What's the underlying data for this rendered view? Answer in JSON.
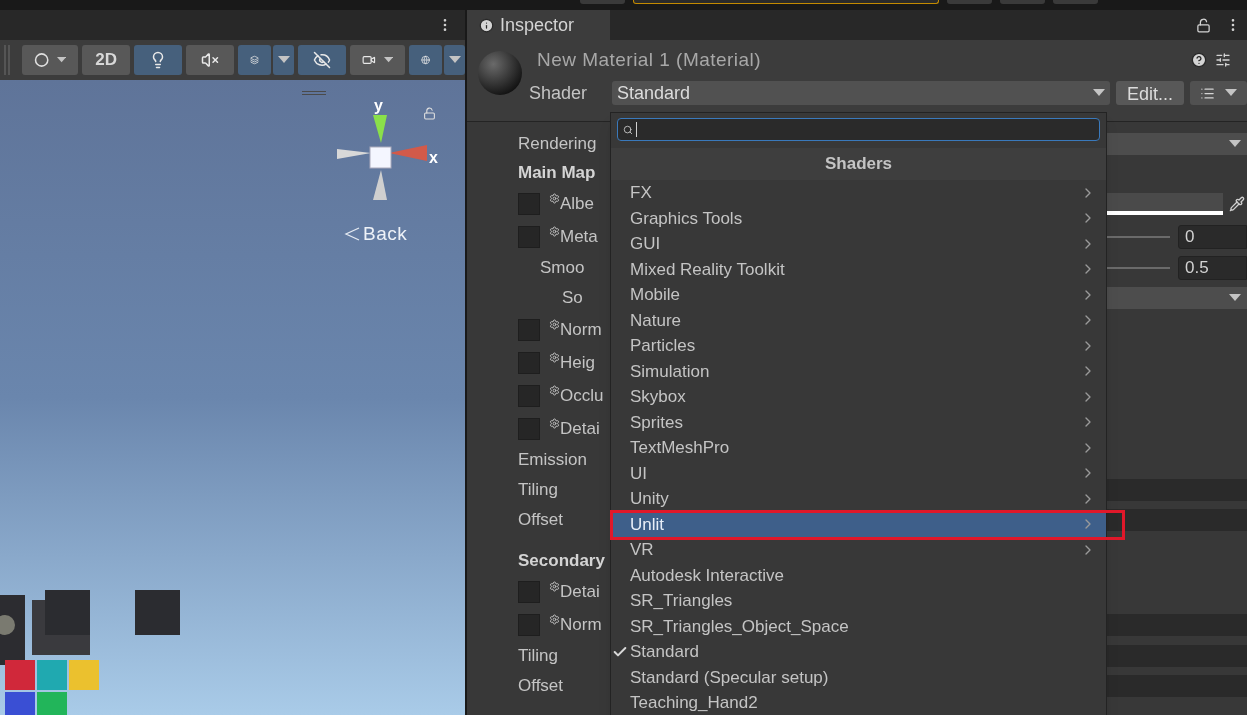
{
  "top_toolbar": [
    {
      "kind": "plain"
    },
    {
      "kind": "accent"
    },
    {
      "kind": "plain"
    },
    {
      "kind": "plain"
    },
    {
      "kind": "plain"
    }
  ],
  "scene": {
    "toolbar": [
      {
        "kind": "draw-mode",
        "on": false,
        "caret": true,
        "split": false
      },
      {
        "kind": "text",
        "label": "2D",
        "on": false,
        "caret": false,
        "split": false
      },
      {
        "kind": "lighting",
        "on": true,
        "caret": false,
        "split": false
      },
      {
        "kind": "audio",
        "on": false,
        "caret": false,
        "split": false
      },
      {
        "kind": "effects",
        "on": true,
        "caret": false,
        "split": true
      },
      {
        "kind": "visibility",
        "on": true,
        "caret": false,
        "split": false
      },
      {
        "kind": "camera",
        "on": false,
        "caret": true,
        "split": false
      },
      {
        "kind": "gizmos",
        "on": true,
        "caret": false,
        "split": true
      }
    ],
    "gizmo": {
      "y_label": "y",
      "x_label": "x",
      "view_label": "Back"
    }
  },
  "inspector": {
    "tab": "Inspector",
    "title": "New Material 1 (Material)",
    "shader_label": "Shader",
    "shader_value": "Standard",
    "edit_button": "Edit...",
    "properties": [
      {
        "kind": "plain",
        "label": "Rendering",
        "value": {
          "kind": "dropdown"
        }
      },
      {
        "kind": "heading",
        "label": "Main Map"
      },
      {
        "kind": "texture",
        "label": "Albe",
        "value": {
          "kind": "color"
        }
      },
      {
        "kind": "texture",
        "label": "Meta",
        "value": {
          "kind": "slider",
          "text": "0"
        },
        "children": [
          {
            "kind": "plain",
            "label": "Smoo",
            "value": {
              "kind": "slider",
              "text": "0.5"
            },
            "children": [
              {
                "kind": "plain",
                "label": "So",
                "value": {
                  "kind": "dropdown"
                }
              }
            ]
          }
        ]
      },
      {
        "kind": "texture",
        "label": "Norm"
      },
      {
        "kind": "texture",
        "label": "Heig"
      },
      {
        "kind": "texture",
        "label": "Occlu"
      },
      {
        "kind": "texture",
        "label": "Detai"
      },
      {
        "kind": "plain",
        "label": "Emission"
      },
      {
        "kind": "plain",
        "label": "Tiling",
        "value": {
          "kind": "field"
        }
      },
      {
        "kind": "plain",
        "label": "Offset",
        "value": {
          "kind": "field"
        }
      },
      {
        "kind": "heading",
        "label": "Secondary"
      },
      {
        "kind": "texture",
        "label": "Detai"
      },
      {
        "kind": "texture",
        "label": "Norm",
        "value": {
          "kind": "field"
        }
      },
      {
        "kind": "plain",
        "label": "Tiling",
        "value": {
          "kind": "field"
        }
      },
      {
        "kind": "plain",
        "label": "Offset",
        "value": {
          "kind": "field"
        }
      }
    ]
  },
  "shader_menu": {
    "title": "Shaders",
    "items": [
      {
        "label": "FX",
        "submenu": true,
        "selected": false,
        "checked": false,
        "outlined": false
      },
      {
        "label": "Graphics Tools",
        "submenu": true,
        "selected": false,
        "checked": false,
        "outlined": false
      },
      {
        "label": "GUI",
        "submenu": true,
        "selected": false,
        "checked": false,
        "outlined": false
      },
      {
        "label": "Mixed Reality Toolkit",
        "submenu": true,
        "selected": false,
        "checked": false,
        "outlined": false
      },
      {
        "label": "Mobile",
        "submenu": true,
        "selected": false,
        "checked": false,
        "outlined": false
      },
      {
        "label": "Nature",
        "submenu": true,
        "selected": false,
        "checked": false,
        "outlined": false
      },
      {
        "label": "Particles",
        "submenu": true,
        "selected": false,
        "checked": false,
        "outlined": false
      },
      {
        "label": "Simulation",
        "submenu": true,
        "selected": false,
        "checked": false,
        "outlined": false
      },
      {
        "label": "Skybox",
        "submenu": true,
        "selected": false,
        "checked": false,
        "outlined": false
      },
      {
        "label": "Sprites",
        "submenu": true,
        "selected": false,
        "checked": false,
        "outlined": false
      },
      {
        "label": "TextMeshPro",
        "submenu": true,
        "selected": false,
        "checked": false,
        "outlined": false
      },
      {
        "label": "UI",
        "submenu": true,
        "selected": false,
        "checked": false,
        "outlined": false
      },
      {
        "label": "Unity",
        "submenu": true,
        "selected": false,
        "checked": false,
        "outlined": false
      },
      {
        "label": "Unlit",
        "submenu": true,
        "selected": true,
        "checked": false,
        "outlined": true
      },
      {
        "label": "VR",
        "submenu": true,
        "selected": false,
        "checked": false,
        "outlined": false
      },
      {
        "label": "Autodesk Interactive",
        "submenu": false,
        "selected": false,
        "checked": false,
        "outlined": false
      },
      {
        "label": "SR_Triangles",
        "submenu": false,
        "selected": false,
        "checked": false,
        "outlined": false
      },
      {
        "label": "SR_Triangles_Object_Space",
        "submenu": false,
        "selected": false,
        "checked": false,
        "outlined": false
      },
      {
        "label": "Standard",
        "submenu": false,
        "selected": false,
        "checked": true,
        "outlined": false
      },
      {
        "label": "Standard (Specular setup)",
        "submenu": false,
        "selected": false,
        "checked": false,
        "outlined": false
      },
      {
        "label": "Teaching_Hand2",
        "submenu": false,
        "selected": false,
        "checked": false,
        "outlined": false
      }
    ]
  }
}
